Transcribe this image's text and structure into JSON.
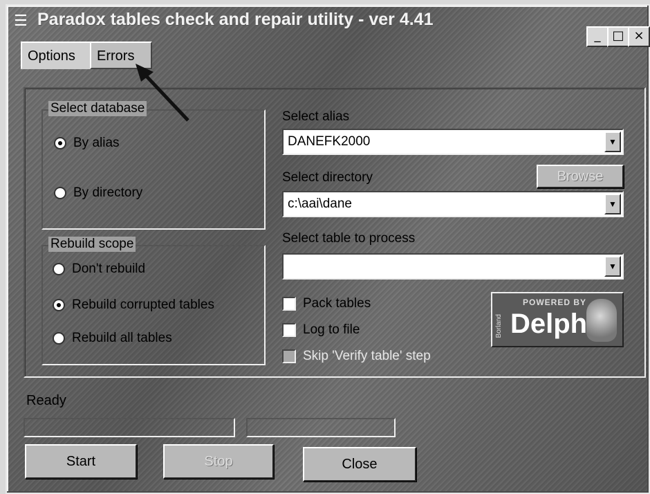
{
  "window": {
    "title": "Paradox tables check and repair utility - ver 4.41",
    "controls": {
      "minimize": "_",
      "maximize": "□",
      "close": "×"
    }
  },
  "tabs": [
    {
      "label": "Options",
      "active": true
    },
    {
      "label": "Errors",
      "active": false
    }
  ],
  "select_database": {
    "legend": "Select database",
    "options": [
      {
        "label": "By alias",
        "selected": true
      },
      {
        "label": "By directory",
        "selected": false
      }
    ]
  },
  "rebuild_scope": {
    "legend": "Rebuild scope",
    "options": [
      {
        "label": "Don't rebuild",
        "selected": false
      },
      {
        "label": "Rebuild corrupted tables",
        "selected": true
      },
      {
        "label": "Rebuild all tables",
        "selected": false
      }
    ]
  },
  "alias": {
    "label": "Select alias",
    "value": "DANEFK2000"
  },
  "directory": {
    "label": "Select directory",
    "value": "c:\\aai\\dane",
    "browse_label": "Browse"
  },
  "table": {
    "label": "Select table to process",
    "value": ""
  },
  "checkboxes": [
    {
      "label": "Pack tables",
      "checked": false,
      "enabled": true
    },
    {
      "label": "Log to file",
      "checked": false,
      "enabled": true
    },
    {
      "label": "Skip 'Verify table' step",
      "checked": false,
      "enabled": false
    }
  ],
  "delphi_badge": {
    "powered": "POWERED BY",
    "word": "Delphi",
    "side": "Borland"
  },
  "status": {
    "text": "Ready"
  },
  "buttons": {
    "start": "Start",
    "stop": "Stop",
    "close": "Close"
  },
  "icons": {
    "title": "menu-lines-icon",
    "dropdown": "triangle-down-icon"
  }
}
